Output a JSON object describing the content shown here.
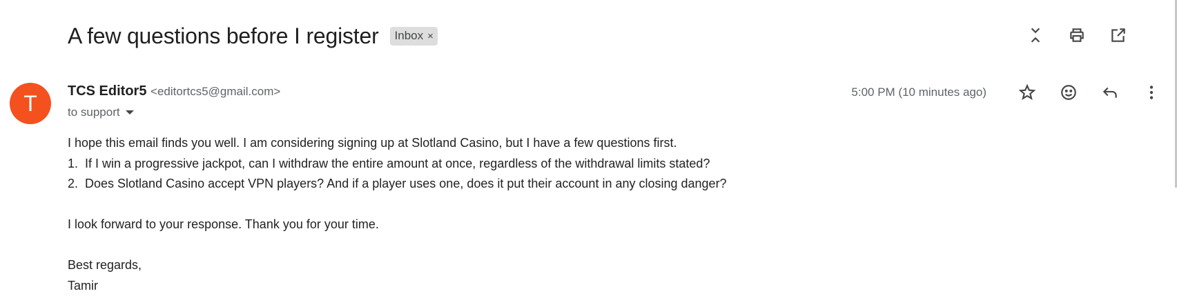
{
  "email": {
    "subject": "A few questions before I register",
    "label": "Inbox",
    "label_remove": "×",
    "sender_initial": "T",
    "sender_name": "TCS Editor5",
    "sender_email": "<editortcs5@gmail.com>",
    "to": "to support",
    "time": "5:00 PM (10 minutes ago)",
    "body": {
      "line1": "I hope this email finds you well. I am considering signing up at Slotland Casino, but I have a few questions first.",
      "line2": "1.  If I win a progressive jackpot, can I withdraw the entire amount at once, regardless of the withdrawal limits stated?",
      "line3": "2.  Does Slotland Casino accept VPN players? And if a player uses one, does it put their account in any closing danger?",
      "line4": "I look forward to your response. Thank you for your time.",
      "line5": "Best regards,",
      "line6": "Tamir"
    }
  },
  "icons": {
    "top": [
      "collapse-icon",
      "print-icon",
      "open-new-window-icon"
    ],
    "message": [
      "star-icon",
      "emoji-icon",
      "reply-icon",
      "more-vert-icon"
    ]
  },
  "colors": {
    "avatar": "#f4511e",
    "chip": "#dddddd"
  }
}
